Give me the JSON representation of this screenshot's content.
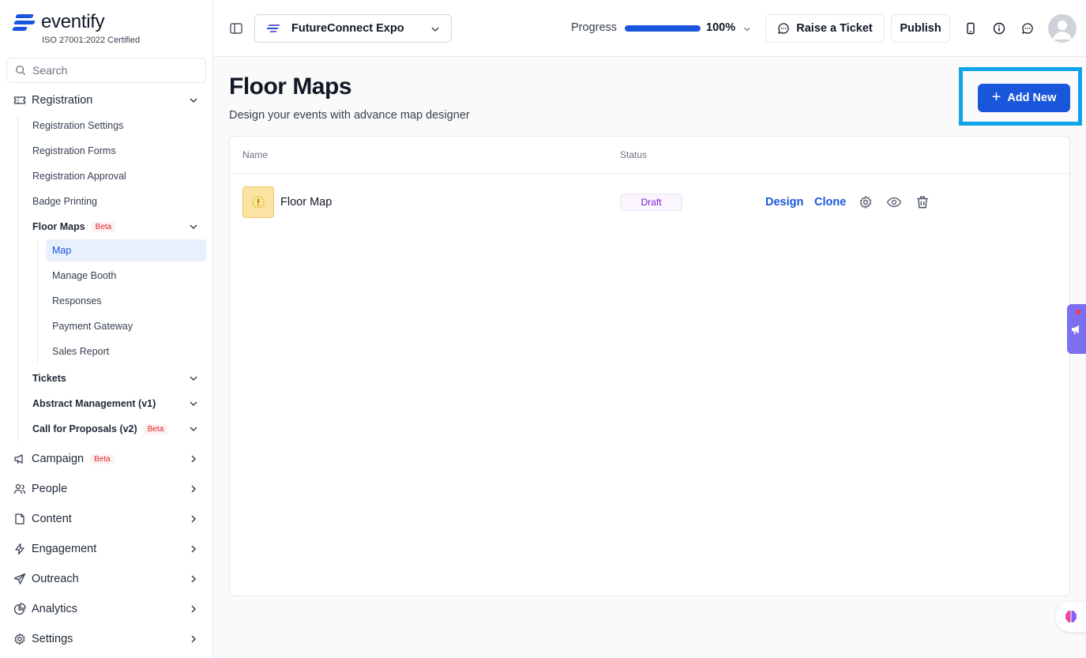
{
  "brand": {
    "name": "eventify",
    "certification": "ISO 27001:2022 Certified"
  },
  "search": {
    "placeholder": "Search"
  },
  "sidebar": {
    "registration": {
      "label": "Registration",
      "items": [
        "Registration Settings",
        "Registration Forms",
        "Registration Approval",
        "Badge Printing"
      ],
      "floor_maps": {
        "label": "Floor Maps",
        "badge": "Beta",
        "items": [
          "Map",
          "Manage Booth",
          "Responses",
          "Payment Gateway",
          "Sales Report"
        ],
        "active": "Map"
      },
      "groups": [
        {
          "label": "Tickets"
        },
        {
          "label": "Abstract Management (v1)"
        },
        {
          "label": "Call for Proposals (v2)",
          "badge": "Beta"
        }
      ]
    },
    "sections": [
      {
        "label": "Campaign",
        "badge": "Beta",
        "icon": "megaphone-icon"
      },
      {
        "label": "People",
        "icon": "people-icon"
      },
      {
        "label": "Content",
        "icon": "content-icon"
      },
      {
        "label": "Engagement",
        "icon": "lightning-icon"
      },
      {
        "label": "Outreach",
        "icon": "send-icon"
      },
      {
        "label": "Analytics",
        "icon": "pie-chart-icon"
      },
      {
        "label": "Settings",
        "icon": "gear-icon"
      }
    ]
  },
  "header": {
    "event_name": "FutureConnect Expo",
    "progress_label": "Progress",
    "progress_percent": 100,
    "progress_text": "100%",
    "raise_ticket_label": "Raise a Ticket",
    "publish_label": "Publish"
  },
  "main": {
    "title": "Floor Maps",
    "subtitle": "Design your events with advance map designer",
    "add_new_label": "Add New",
    "table": {
      "columns": [
        "Name",
        "Status"
      ],
      "rows": [
        {
          "name": "Floor Map",
          "status": "Draft",
          "actions": {
            "design": "Design",
            "clone": "Clone"
          }
        }
      ]
    }
  },
  "colors": {
    "accent": "#1a56db",
    "highlight": "#0ea5e9",
    "beta": "#dc2626",
    "draft": "#7e22ce"
  }
}
